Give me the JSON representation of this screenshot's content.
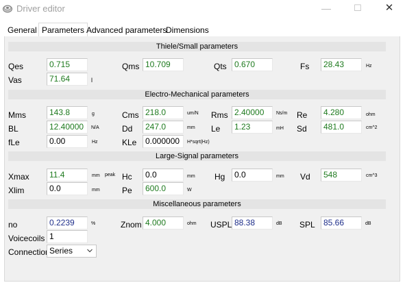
{
  "window": {
    "title": "Driver editor",
    "minimize_glyph": "—",
    "maximize_glyph": "☐",
    "close_glyph": "✕"
  },
  "tabs": [
    {
      "label": "General",
      "active": false
    },
    {
      "label": "Parameters",
      "active": true
    },
    {
      "label": "Advanced parameters",
      "active": false
    },
    {
      "label": "Dimensions",
      "active": false
    }
  ],
  "sections": {
    "thiele_small": "Thiele/Small parameters",
    "electro_mechanical": "Electro-Mechanical parameters",
    "large_signal": "Large-Signal parameters",
    "misc": "Miscellaneous parameters"
  },
  "params": {
    "qes": {
      "label": "Qes",
      "value": "0.715",
      "unit": ""
    },
    "qms": {
      "label": "Qms",
      "value": "10.709",
      "unit": ""
    },
    "qts": {
      "label": "Qts",
      "value": "0.670",
      "unit": ""
    },
    "fs": {
      "label": "Fs",
      "value": "28.43",
      "unit": "Hz"
    },
    "vas": {
      "label": "Vas",
      "value": "71.64",
      "unit": "l"
    },
    "mms": {
      "label": "Mms",
      "value": "143.8",
      "unit": "g"
    },
    "cms": {
      "label": "Cms",
      "value": "218.0",
      "unit": "um/N"
    },
    "rms": {
      "label": "Rms",
      "value": "2.40000",
      "unit": "Ns/m"
    },
    "re": {
      "label": "Re",
      "value": "4.280",
      "unit": "ohm"
    },
    "bl": {
      "label": "BL",
      "value": "12.40000",
      "unit": "N/A"
    },
    "dd": {
      "label": "Dd",
      "value": "247.0",
      "unit": "mm"
    },
    "le": {
      "label": "Le",
      "value": "1.23",
      "unit": "mH"
    },
    "sd": {
      "label": "Sd",
      "value": "481.0",
      "unit": "cm^2"
    },
    "fle": {
      "label": "fLe",
      "value": "0.00",
      "unit": "Hz"
    },
    "kle": {
      "label": "KLe",
      "value": "0.000000",
      "unit": "H*sqrt(Hz)"
    },
    "xmax": {
      "label": "Xmax",
      "value": "11.4",
      "unit": "mm",
      "unit2": "peak"
    },
    "hc": {
      "label": "Hc",
      "value": "0.0",
      "unit": "mm"
    },
    "hg": {
      "label": "Hg",
      "value": "0.0",
      "unit": "mm"
    },
    "vd": {
      "label": "Vd",
      "value": "548",
      "unit": "cm^3"
    },
    "xlim": {
      "label": "Xlim",
      "value": "0.0",
      "unit": "mm"
    },
    "pe": {
      "label": "Pe",
      "value": "600.0",
      "unit": "W"
    },
    "no": {
      "label": "no",
      "value": "0.2239",
      "unit": "%"
    },
    "znom": {
      "label": "Znom",
      "value": "4.000",
      "unit": "ohm"
    },
    "uspl": {
      "label": "USPL",
      "value": "88.38",
      "unit": "dB"
    },
    "spl": {
      "label": "SPL",
      "value": "85.66",
      "unit": "dB"
    },
    "voicecoils": {
      "label": "Voicecoils",
      "value": "1"
    },
    "connection": {
      "label": "Connection",
      "value": "Series"
    }
  },
  "colors": {
    "value_green": "#1e7a1e",
    "value_blue": "#1e2e8a",
    "section_bg": "#e4e4e4",
    "panel_bg": "#f0f0f0"
  }
}
